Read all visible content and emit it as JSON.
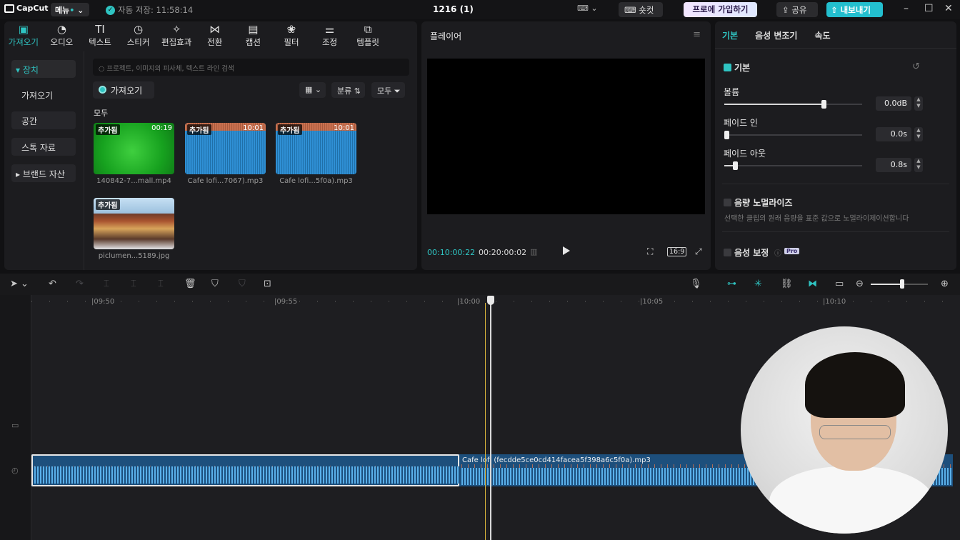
{
  "titlebar": {
    "app_name": "CapCut",
    "menu_label": "메뉴",
    "autosave": "자동 저장: 11:58:14",
    "project_title": "1216 (1)",
    "shortcut_label": "숏컷",
    "pro_label": "프로에 가입하기",
    "share_label": "공유",
    "export_label": "내보내기"
  },
  "media_tabs": [
    {
      "label": "가져오기",
      "icon": "import-icon"
    },
    {
      "label": "오디오",
      "icon": "audio-icon"
    },
    {
      "label": "텍스트",
      "icon": "text-icon"
    },
    {
      "label": "스티커",
      "icon": "sticker-icon"
    },
    {
      "label": "편집효과",
      "icon": "effects-icon"
    },
    {
      "label": "전환",
      "icon": "transition-icon"
    },
    {
      "label": "캡션",
      "icon": "caption-icon"
    },
    {
      "label": "필터",
      "icon": "filter-icon"
    },
    {
      "label": "조정",
      "icon": "adjust-icon"
    },
    {
      "label": "템플릿",
      "icon": "template-icon"
    }
  ],
  "sidebar": {
    "items": [
      "장치",
      "가져오기",
      "공간",
      "스톡 자료",
      "브랜드 자산"
    ]
  },
  "media": {
    "search_placeholder": "프로젝트, 이미지의 피사체, 텍스트 라인 검색",
    "import_button": "가져오기",
    "sort_label": "분류",
    "filter_label": "모두",
    "section_label": "모두",
    "added_badge": "추가됨",
    "items": [
      {
        "name": "140842-7...mall.mp4",
        "duration": "00:19"
      },
      {
        "name": "Cafe lofi...7067).mp3",
        "duration": "10:01"
      },
      {
        "name": "Cafe lofi...5f0a).mp3",
        "duration": "10:01"
      },
      {
        "name": "piclumen...5189.jpg",
        "duration": ""
      }
    ]
  },
  "player": {
    "title": "플레이어",
    "current_time": "00:10:00:22",
    "total_time": "00:20:00:02",
    "ratio": "16:9"
  },
  "properties": {
    "tabs": [
      "기본",
      "음성 변조기",
      "속도"
    ],
    "section_basic": "기본",
    "volume_label": "볼륨",
    "volume_value": "0.0dB",
    "volume_level": 0.72,
    "fade_in_label": "페이드 인",
    "fade_in_value": "0.0s",
    "fade_in_level": 0.0,
    "fade_out_label": "페이드 아웃",
    "fade_out_value": "0.8s",
    "fade_out_level": 0.08,
    "normalize_label": "음량 노멀라이즈",
    "normalize_desc": "선택한 클립의 원래 음량을 표준 값으로 노멀라이제이션합니다",
    "enhance_label": "음성 보정",
    "pro_tag": "Pro"
  },
  "timeline": {
    "ruler_labels": [
      "09:50",
      "09:55",
      "10:00",
      "10:05",
      "10:10"
    ],
    "clip_name": "Cafe lofi (fecdde5ce0cd414facea5f398a6c5f0a).mp3"
  },
  "colors": {
    "accent": "#2fc4c2",
    "export": "#23bfcf",
    "audio_clip": "#1d4f7c"
  }
}
